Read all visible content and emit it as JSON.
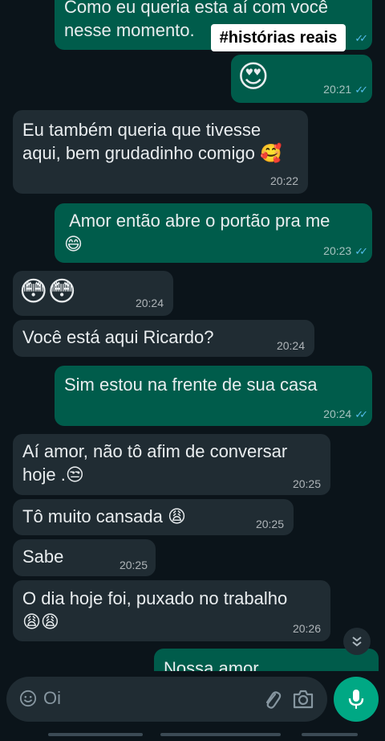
{
  "overlay_tag": "#histórias reais",
  "messages": [
    {
      "text": "Como eu queria esta aí com você\nnesse momento.",
      "time": ""
    },
    {
      "text": "😍",
      "time": "20:21"
    },
    {
      "text": "Eu também queria que tivesse\naqui, bem grudadinho comigo 🥰",
      "time": "20:22"
    },
    {
      "text": " Amor então abre o portão pra me\n😄",
      "time": "20:23"
    },
    {
      "text": "😳😳",
      "time": "20:24"
    },
    {
      "text": "Você está aqui Ricardo?",
      "time": "20:24"
    },
    {
      "text": "Sim estou na frente de sua casa",
      "time": "20:24"
    },
    {
      "text": "Aí amor, não tô afim de conversar\nhoje .😒",
      "time": "20:25"
    },
    {
      "text": "Tô muito cansada 😩",
      "time": "20:25"
    },
    {
      "text": "Sabe",
      "time": "20:25"
    },
    {
      "text": "O dia hoje foi, puxado no trabalho\n😩😩",
      "time": "20:26"
    },
    {
      "text": "Nossa amor",
      "time": ""
    }
  ],
  "composer": {
    "placeholder": "Oi"
  },
  "icons": {
    "emoji": "emoji-icon",
    "attach": "paperclip-icon",
    "camera": "camera-icon",
    "mic": "mic-icon",
    "scroll_down": "double-chevron-down-icon",
    "read_receipt": "double-check-icon"
  },
  "colors": {
    "background": "#0b141a",
    "outgoing_bubble": "#005c4b",
    "incoming_bubble": "#202c33",
    "read_ticks": "#53bdeb",
    "mic_button": "#00a884"
  }
}
